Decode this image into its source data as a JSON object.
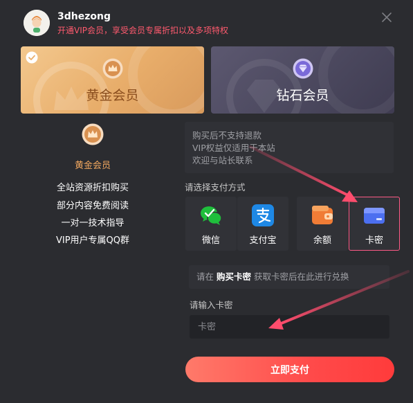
{
  "header": {
    "username": "3dhezong",
    "subtitle": "开通VIP会员，享受会员专属折扣以及多项特权"
  },
  "icons": {
    "avatar": "user-avatar",
    "close": "close-icon",
    "selected": "check-icon",
    "gold_medal": "crown-medal-icon",
    "diamond_medal": "diamond-medal-icon",
    "wechat": "wechat-icon",
    "alipay": "alipay-icon",
    "balance": "wallet-icon",
    "card": "card-icon"
  },
  "tiers": [
    {
      "name": "黄金会员",
      "selected": true
    },
    {
      "name": "钻石会员",
      "selected": false
    }
  ],
  "benefits": {
    "title": "黄金会员",
    "items": [
      "全站资源折扣购买",
      "部分内容免费阅读",
      "一对一技术指导",
      "VIP用户专属QQ群"
    ]
  },
  "notice": {
    "lines": [
      "购买后不支持退款",
      "VIP权益仅适用于本站",
      "欢迎与站长联系"
    ]
  },
  "payment": {
    "label": "请选择支付方式",
    "methods": [
      {
        "name": "微信",
        "selected": false
      },
      {
        "name": "支付宝",
        "selected": false
      },
      {
        "name": "余额",
        "selected": false
      },
      {
        "name": "卡密",
        "selected": true
      }
    ]
  },
  "card_section": {
    "hint_prefix": "请在",
    "hint_link": "购买卡密",
    "hint_suffix": "获取卡密后在此进行兑换",
    "input_label": "请输入卡密",
    "input_placeholder": "卡密",
    "input_value": ""
  },
  "actions": {
    "pay_label": "立即支付"
  },
  "colors": {
    "background": "#2b2c30",
    "accent_red": "#ff4a4a",
    "subtitle_red": "#ff5a6e",
    "gold": "#f1a75f",
    "selected_border": "#ff5a87",
    "annotation_arrow": "#ff4d6d"
  }
}
